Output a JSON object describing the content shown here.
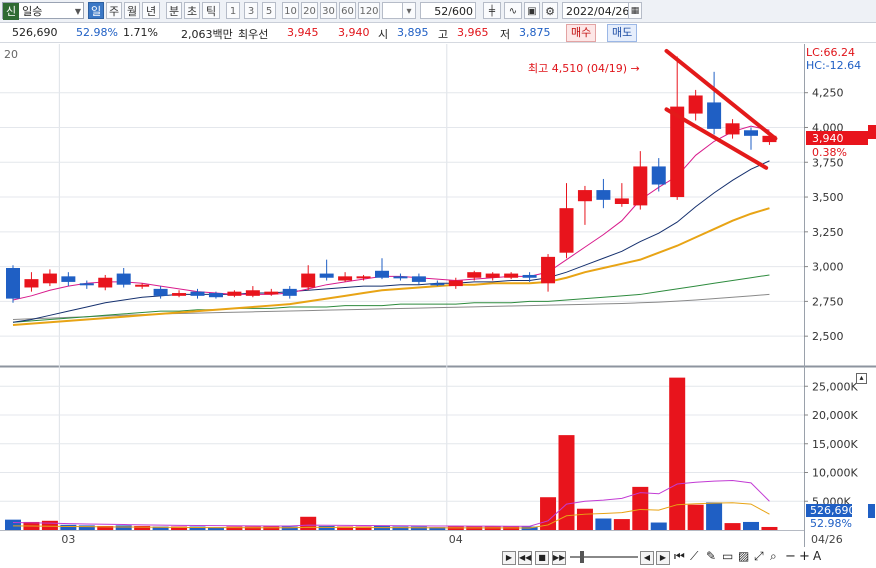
{
  "toolbar": {
    "code_tag": "신",
    "stock_name": "일승",
    "periods": [
      "일",
      "주",
      "월",
      "년",
      "분",
      "초",
      "틱"
    ],
    "selected_period": "일",
    "intervals": [
      "1",
      "3",
      "5",
      "10",
      "20",
      "30",
      "60",
      "120"
    ],
    "count_value": "52",
    "count_total": "/600",
    "date": "2022/04/26"
  },
  "info": {
    "volume": "526,690",
    "volume_ratio": "52.98%",
    "turnover": "1.71%",
    "amount": "2,063백만",
    "best_label": "최우선",
    "ask": "3,945",
    "bid": "3,940",
    "open_label": "시",
    "open": "3,895",
    "high_label": "고",
    "high": "3,965",
    "low_label": "저",
    "low": "3,875",
    "buy_label": "매수",
    "sell_label": "매도"
  },
  "chart_labels": {
    "ma_period": "20",
    "lc": "LC:66.24",
    "hc": "HC:-12.64",
    "annotation": "최고 4,510 (04/19) →",
    "current_price": "3,940",
    "current_change": "0.38%",
    "current_volume": "526,690",
    "current_volume_pct": "52.98%",
    "date_label": "04/26",
    "month_labels": [
      "03",
      "04"
    ]
  },
  "colors": {
    "up": "#e8141c",
    "down": "#1f5fc4",
    "ma5": "#d81b8c",
    "ma20": "#15306e",
    "ma60": "#e8a415",
    "ma120": "#2e8b3e",
    "ma240": "#8a8a8a",
    "trend": "#e31a1a"
  },
  "chart_data": [
    {
      "type": "candlestick",
      "title": "",
      "y_ticks": [
        2500,
        2750,
        3000,
        3250,
        3500,
        3750,
        4000,
        4250
      ],
      "ylim": [
        2300,
        4600
      ],
      "last_date": "04/26",
      "x_labels": [
        {
          "index": 3,
          "label": "03"
        },
        {
          "index": 24,
          "label": "04"
        }
      ],
      "candles": [
        {
          "o": 2990,
          "c": 2770,
          "h": 3010,
          "l": 2740
        },
        {
          "o": 2850,
          "c": 2910,
          "h": 2960,
          "l": 2820
        },
        {
          "o": 2880,
          "c": 2950,
          "h": 2980,
          "l": 2860
        },
        {
          "o": 2930,
          "c": 2890,
          "h": 2960,
          "l": 2860
        },
        {
          "o": 2880,
          "c": 2870,
          "h": 2900,
          "l": 2840
        },
        {
          "o": 2850,
          "c": 2920,
          "h": 2940,
          "l": 2830
        },
        {
          "o": 2950,
          "c": 2870,
          "h": 2990,
          "l": 2850
        },
        {
          "o": 2860,
          "c": 2870,
          "h": 2880,
          "l": 2840
        },
        {
          "o": 2840,
          "c": 2790,
          "h": 2860,
          "l": 2770
        },
        {
          "o": 2790,
          "c": 2810,
          "h": 2830,
          "l": 2780
        },
        {
          "o": 2820,
          "c": 2790,
          "h": 2840,
          "l": 2770
        },
        {
          "o": 2810,
          "c": 2780,
          "h": 2820,
          "l": 2770
        },
        {
          "o": 2790,
          "c": 2820,
          "h": 2830,
          "l": 2780
        },
        {
          "o": 2790,
          "c": 2830,
          "h": 2860,
          "l": 2780
        },
        {
          "o": 2800,
          "c": 2820,
          "h": 2840,
          "l": 2790
        },
        {
          "o": 2840,
          "c": 2790,
          "h": 2860,
          "l": 2770
        },
        {
          "o": 2850,
          "c": 2950,
          "h": 3010,
          "l": 2830
        },
        {
          "o": 2950,
          "c": 2920,
          "h": 3050,
          "l": 2900
        },
        {
          "o": 2900,
          "c": 2930,
          "h": 2960,
          "l": 2890
        },
        {
          "o": 2920,
          "c": 2930,
          "h": 2940,
          "l": 2900
        },
        {
          "o": 2970,
          "c": 2920,
          "h": 3060,
          "l": 2910
        },
        {
          "o": 2930,
          "c": 2920,
          "h": 2950,
          "l": 2900
        },
        {
          "o": 2930,
          "c": 2890,
          "h": 2950,
          "l": 2870
        },
        {
          "o": 2880,
          "c": 2870,
          "h": 2900,
          "l": 2860
        },
        {
          "o": 2860,
          "c": 2900,
          "h": 2920,
          "l": 2840
        },
        {
          "o": 2920,
          "c": 2960,
          "h": 2970,
          "l": 2900
        },
        {
          "o": 2920,
          "c": 2950,
          "h": 2960,
          "l": 2900
        },
        {
          "o": 2920,
          "c": 2950,
          "h": 2960,
          "l": 2910
        },
        {
          "o": 2940,
          "c": 2920,
          "h": 2960,
          "l": 2890
        },
        {
          "o": 2880,
          "c": 3070,
          "h": 3090,
          "l": 2820
        },
        {
          "o": 3100,
          "c": 3420,
          "h": 3600,
          "l": 3060
        },
        {
          "o": 3470,
          "c": 3550,
          "h": 3580,
          "l": 3300
        },
        {
          "o": 3550,
          "c": 3480,
          "h": 3630,
          "l": 3420
        },
        {
          "o": 3450,
          "c": 3490,
          "h": 3600,
          "l": 3430
        },
        {
          "o": 3440,
          "c": 3720,
          "h": 3830,
          "l": 3410
        },
        {
          "o": 3720,
          "c": 3590,
          "h": 3780,
          "l": 3540
        },
        {
          "o": 3500,
          "c": 4150,
          "h": 4510,
          "l": 3480
        },
        {
          "o": 4100,
          "c": 4230,
          "h": 4270,
          "l": 4050
        },
        {
          "o": 4180,
          "c": 3990,
          "h": 4400,
          "l": 3950
        },
        {
          "o": 3950,
          "c": 4030,
          "h": 4060,
          "l": 3920
        },
        {
          "o": 3980,
          "c": 3940,
          "h": 4000,
          "l": 3840
        },
        {
          "o": 3895,
          "c": 3940,
          "h": 3965,
          "l": 3875
        }
      ],
      "ma5": [
        2760,
        2790,
        2830,
        2860,
        2880,
        2890,
        2890,
        2880,
        2860,
        2840,
        2820,
        2810,
        2800,
        2800,
        2800,
        2810,
        2840,
        2870,
        2890,
        2910,
        2930,
        2930,
        2920,
        2910,
        2900,
        2910,
        2920,
        2930,
        2930,
        2960,
        3050,
        3140,
        3230,
        3330,
        3480,
        3570,
        3650,
        3800,
        3900,
        3970,
        4010,
        3980
      ],
      "ma20": [
        2600,
        2620,
        2650,
        2680,
        2710,
        2740,
        2760,
        2780,
        2790,
        2800,
        2800,
        2800,
        2800,
        2810,
        2810,
        2820,
        2830,
        2840,
        2850,
        2860,
        2860,
        2870,
        2870,
        2880,
        2880,
        2890,
        2890,
        2900,
        2900,
        2920,
        2960,
        3010,
        3060,
        3110,
        3180,
        3240,
        3320,
        3430,
        3530,
        3620,
        3700,
        3760
      ],
      "ma60": [
        2580,
        2590,
        2600,
        2610,
        2620,
        2630,
        2640,
        2650,
        2660,
        2670,
        2680,
        2690,
        2700,
        2710,
        2720,
        2730,
        2750,
        2770,
        2790,
        2810,
        2830,
        2840,
        2850,
        2860,
        2870,
        2870,
        2880,
        2880,
        2880,
        2890,
        2920,
        2960,
        2990,
        3020,
        3050,
        3100,
        3150,
        3210,
        3270,
        3330,
        3380,
        3420
      ],
      "ma120": [
        2600,
        2610,
        2620,
        2630,
        2640,
        2650,
        2660,
        2670,
        2680,
        2680,
        2690,
        2690,
        2700,
        2700,
        2700,
        2710,
        2710,
        2710,
        2720,
        2720,
        2720,
        2730,
        2730,
        2730,
        2730,
        2740,
        2740,
        2740,
        2750,
        2750,
        2760,
        2770,
        2780,
        2790,
        2800,
        2820,
        2840,
        2860,
        2880,
        2900,
        2920,
        2940
      ],
      "ma240": [
        2620,
        2625,
        2630,
        2635,
        2640,
        2645,
        2650,
        2655,
        2660,
        2663,
        2666,
        2669,
        2672,
        2675,
        2678,
        2681,
        2684,
        2687,
        2690,
        2693,
        2696,
        2699,
        2702,
        2705,
        2708,
        2711,
        2714,
        2717,
        2720,
        2723,
        2726,
        2729,
        2732,
        2735,
        2740,
        2745,
        2752,
        2760,
        2770,
        2780,
        2790,
        2800
      ],
      "trend_upper": [
        {
          "i": 35.8,
          "v": 4550
        },
        {
          "i": 41.7,
          "v": 3920
        }
      ],
      "trend_lower": [
        {
          "i": 35.8,
          "v": 4130
        },
        {
          "i": 41.2,
          "v": 3710
        }
      ]
    },
    {
      "type": "bar",
      "title": "",
      "y_ticks": [
        5000,
        10000,
        15000,
        20000,
        25000
      ],
      "y_tick_labels": [
        "5,000K",
        "10,000K",
        "15,000K",
        "20,000K",
        "25,000K"
      ],
      "ylim": [
        0,
        28000
      ],
      "volumes": [
        1800,
        1400,
        1600,
        900,
        800,
        700,
        800,
        700,
        600,
        600,
        600,
        500,
        600,
        600,
        600,
        600,
        2300,
        700,
        600,
        600,
        700,
        600,
        600,
        500,
        600,
        600,
        600,
        600,
        600,
        5700,
        16500,
        3700,
        2000,
        1900,
        7500,
        1300,
        26500,
        4400,
        4800,
        1200,
        1400,
        527
      ],
      "vol_ma": [
        1300,
        1250,
        1200,
        1100,
        1050,
        1000,
        950,
        900,
        850,
        800,
        780,
        760,
        740,
        720,
        700,
        700,
        850,
        820,
        800,
        780,
        760,
        740,
        720,
        700,
        690,
        680,
        670,
        660,
        650,
        1600,
        4500,
        5000,
        5200,
        5500,
        6500,
        6300,
        8000,
        8300,
        8500,
        8600,
        8200,
        5000
      ]
    }
  ]
}
